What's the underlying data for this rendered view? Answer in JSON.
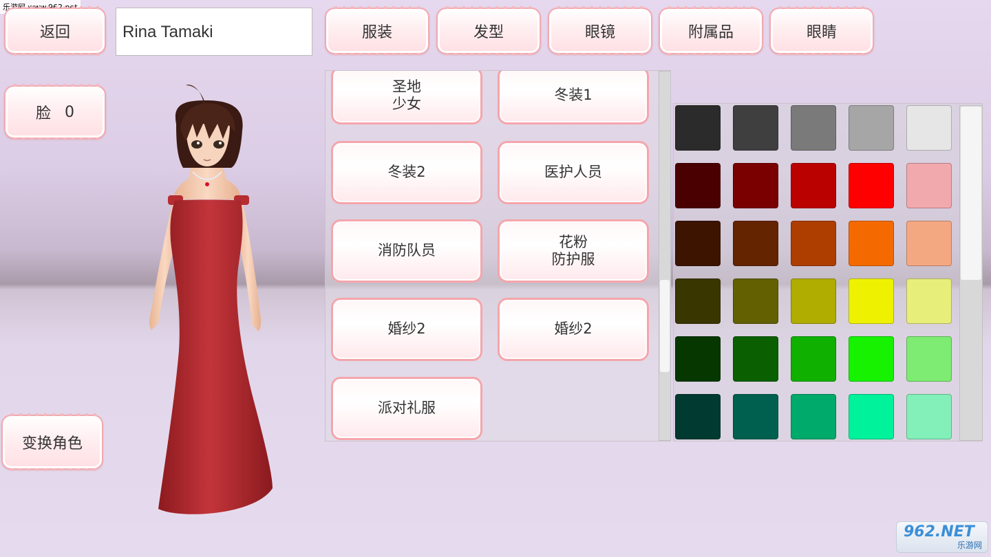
{
  "watermark_top": "乐游网 www.962.net",
  "top_bar": {
    "back_label": "返回",
    "name_value": "Rina Tamaki",
    "tabs": [
      "服装",
      "发型",
      "眼镜",
      "附属品",
      "眼睛"
    ]
  },
  "left_panel": {
    "face_label": "脸",
    "face_value": "0",
    "switch_character_label": "变换角色"
  },
  "outfits": [
    "圣地\n少女",
    "冬装1",
    "冬装2",
    "医护人员",
    "消防队员",
    "花粉\n防护服",
    "婚纱2",
    "婚纱2",
    "派对礼服"
  ],
  "outfit_scroll_fraction": 0.75,
  "color_scroll_fraction": 0.0,
  "colors": [
    [
      "#2b2b2b",
      "#3f3f3f",
      "#7a7a7a",
      "#a6a6a6",
      "#e6e6e6"
    ],
    [
      "#4a0000",
      "#7a0000",
      "#bb0000",
      "#ff0000",
      "#f2a9ad"
    ],
    [
      "#3c1400",
      "#642400",
      "#ad3e00",
      "#f56a00",
      "#f4a882"
    ],
    [
      "#3a3600",
      "#626000",
      "#b0ac00",
      "#eef200",
      "#e8ee7a"
    ],
    [
      "#063700",
      "#0a6000",
      "#10b000",
      "#16f200",
      "#7eec72"
    ],
    [
      "#003a30",
      "#006050",
      "#00aa6a",
      "#00f29a",
      "#82f0b8"
    ]
  ],
  "logo_text": "962.NET",
  "logo_subtext": "乐游网"
}
